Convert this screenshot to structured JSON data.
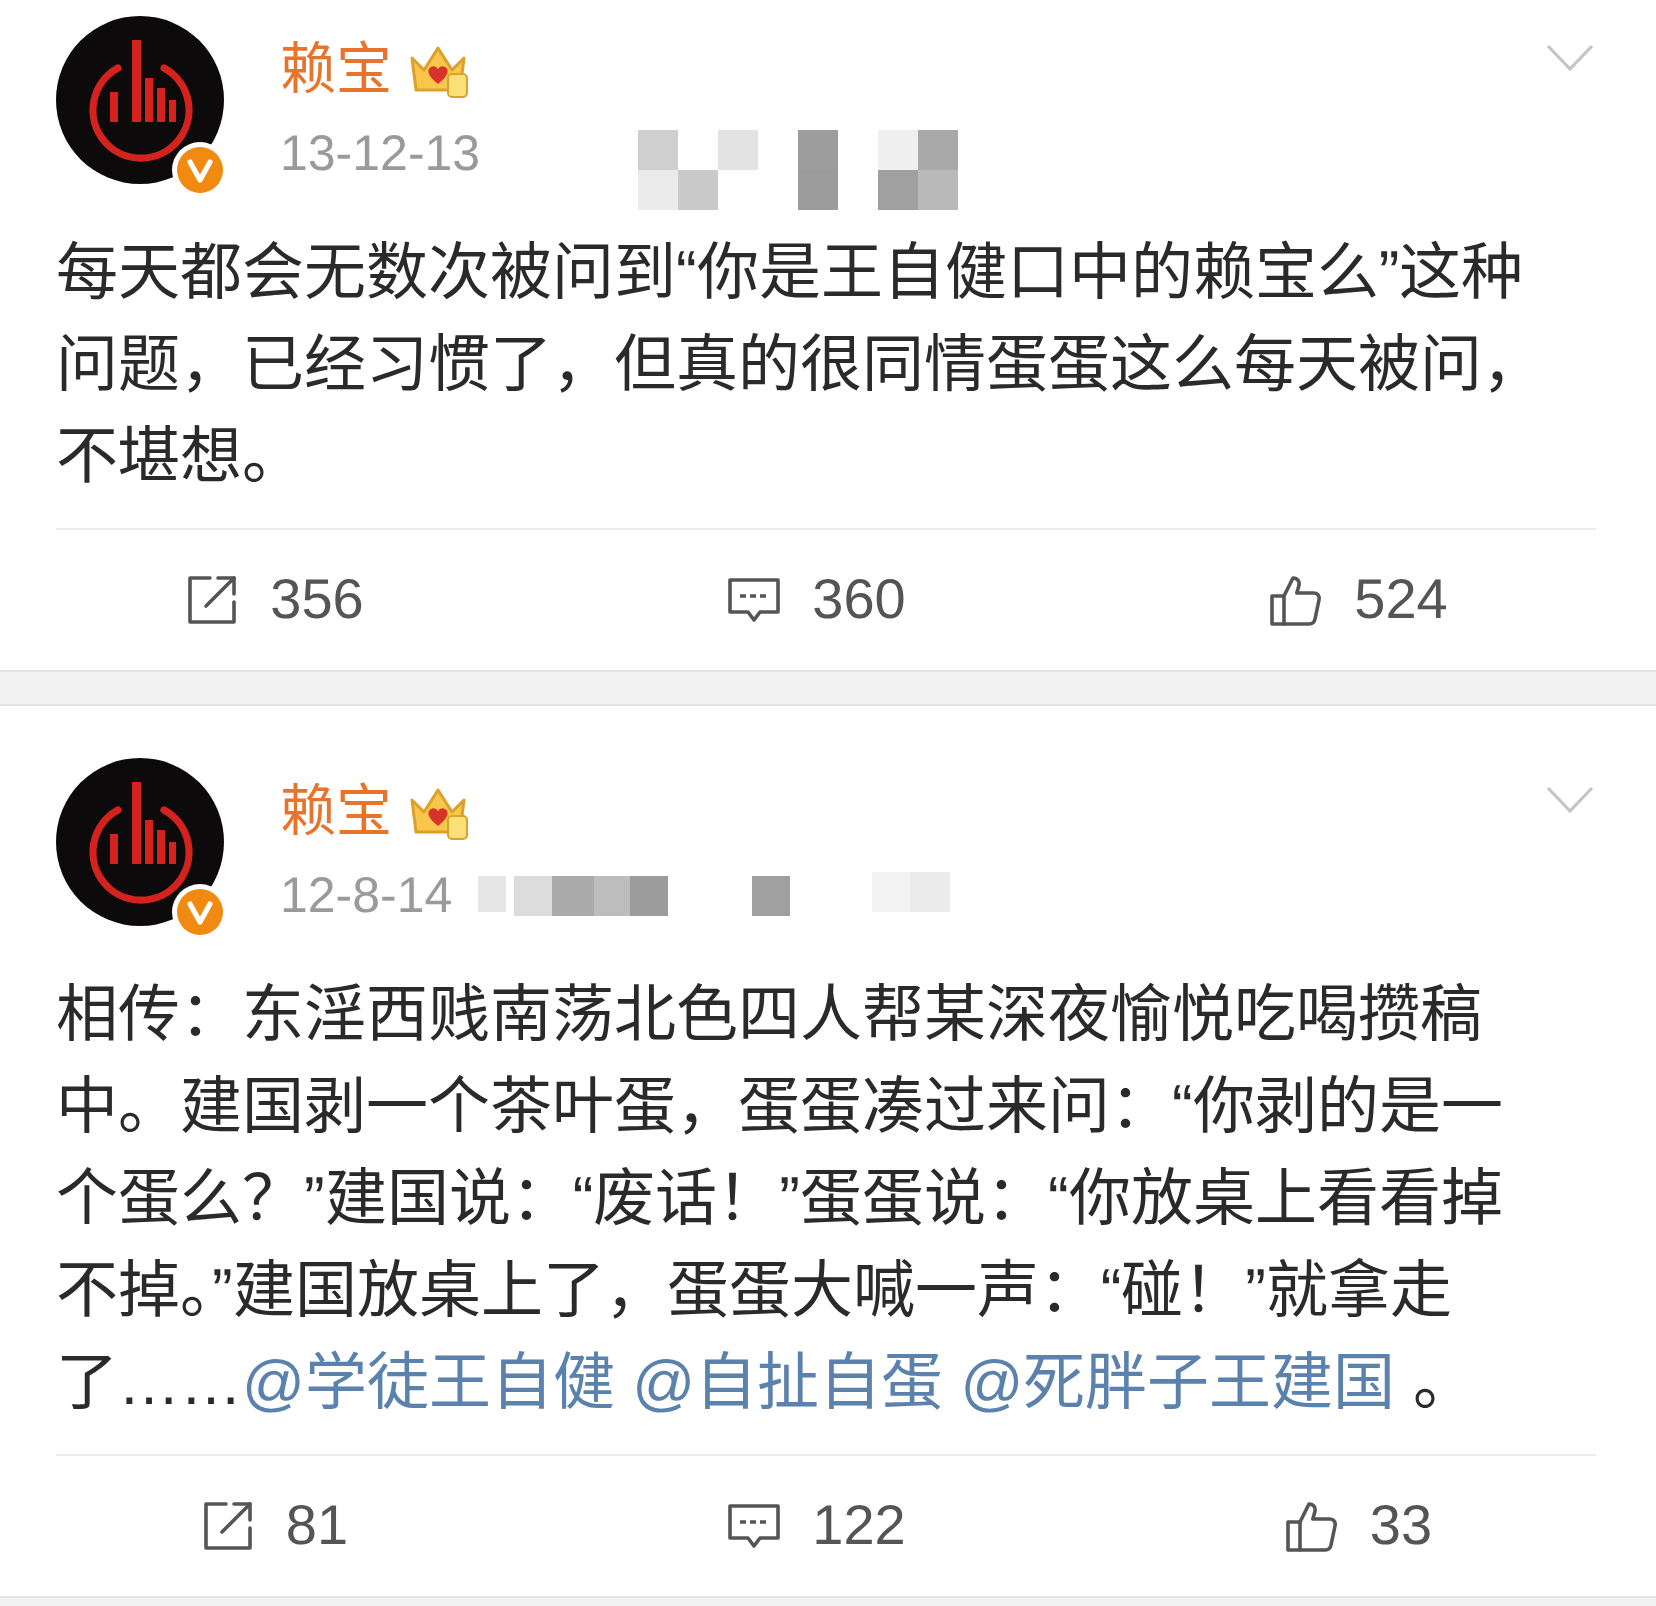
{
  "posts": [
    {
      "author": "赖宝",
      "verified": true,
      "vip": true,
      "time": "13-12-13",
      "source_blurred": true,
      "text_lines": [
        "每天都会无数次被问到“你是王自健口中的赖宝么”这种",
        "问题，已经习惯了，但真的很同情蛋蛋这么每天被问，",
        "不堪想。"
      ],
      "actions": [
        {
          "kind": "repost",
          "count": "356"
        },
        {
          "kind": "comment",
          "count": "360"
        },
        {
          "kind": "like",
          "count": "524"
        }
      ]
    },
    {
      "author": "赖宝",
      "verified": true,
      "vip": true,
      "time": "12-8-14",
      "source_blurred": true,
      "text_lines": [
        "相传：东淫西贱南荡北色四人帮某深夜愉悦吃喝攒稿",
        "中。建国剥一个茶叶蛋，蛋蛋凑过来问：“你剥的是一",
        "个蛋么？”建国说：“废话！”蛋蛋说：“你放桌上看看掉",
        "不掉。”建国放桌上了，蛋蛋大喊一声：“碰！”就拿走",
        "了……"
      ],
      "mentions": [
        "@学徒王自健",
        "@自扯自蛋",
        "@死胖子王建国"
      ],
      "text_end": "。",
      "actions": [
        {
          "kind": "repost",
          "count": "81"
        },
        {
          "kind": "comment",
          "count": "122"
        },
        {
          "kind": "like",
          "count": "33"
        }
      ]
    }
  ]
}
